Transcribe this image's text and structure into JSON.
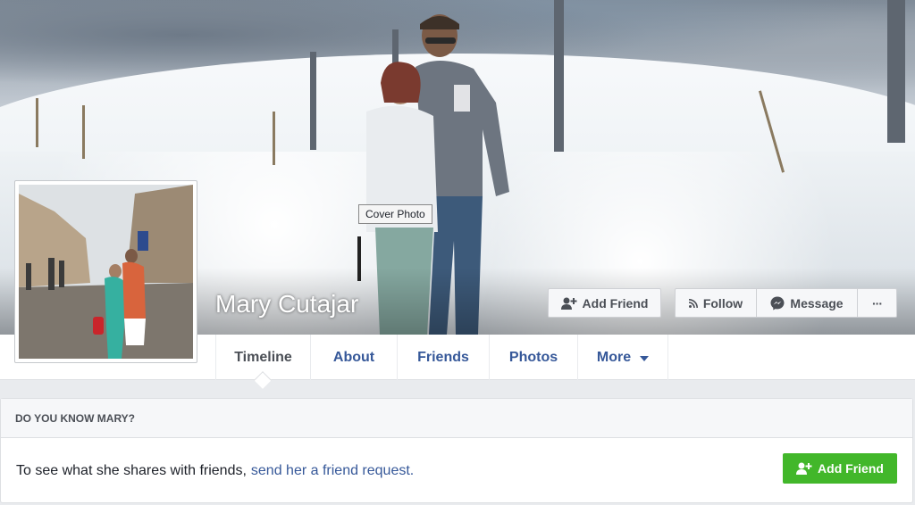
{
  "cover": {
    "tooltip": "Cover Photo"
  },
  "profile": {
    "name": "Mary Cutajar"
  },
  "actions": {
    "add_friend": "Add Friend",
    "follow": "Follow",
    "message": "Message",
    "more": "···"
  },
  "tabs": [
    {
      "label": "Timeline"
    },
    {
      "label": "About"
    },
    {
      "label": "Friends"
    },
    {
      "label": "Photos"
    },
    {
      "label": "More"
    }
  ],
  "know_card": {
    "heading": "DO YOU KNOW MARY?",
    "text": "To see what she shares with friends,",
    "link": "send her a friend request.",
    "button": "Add Friend"
  },
  "colors": {
    "link": "#365899",
    "green": "#42b72a"
  },
  "icons": {
    "add_friend": "add-person-icon",
    "follow": "rss-icon",
    "message": "messenger-icon",
    "more_caret": "caret-down-icon"
  }
}
